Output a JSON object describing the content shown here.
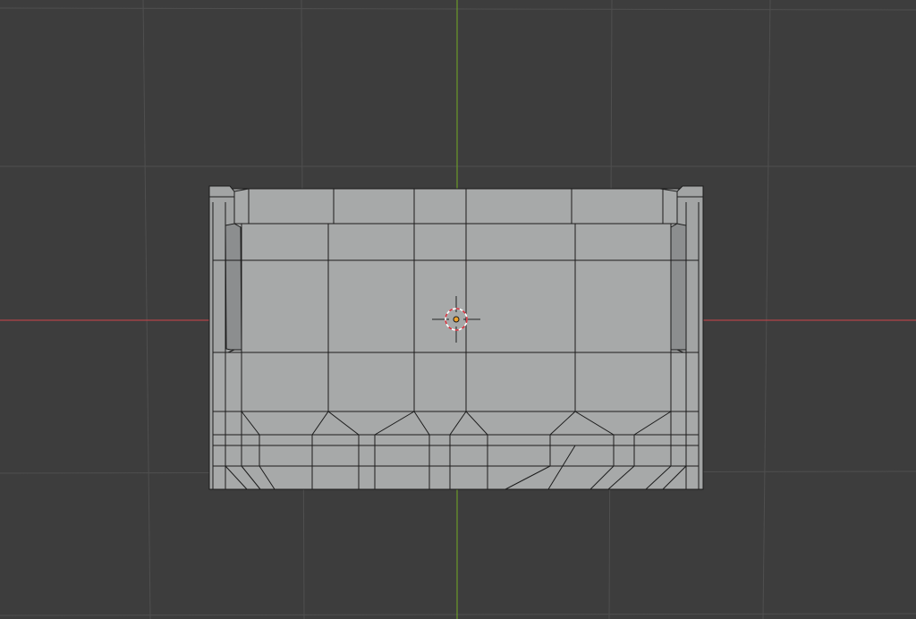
{
  "viewport": {
    "view": "front-orthographic",
    "colors": {
      "background": "#3d3d3d",
      "grid": "#4f4f4f",
      "x_axis": "#b3444a",
      "z_axis": "#6a9a2a",
      "mesh_face": "#a7a9a9",
      "mesh_wire": "#1c1c1c"
    },
    "object": {
      "name": "mesh-object",
      "selected": false
    },
    "cursor": {
      "name": "3d-cursor"
    },
    "origin": {
      "name": "object-origin"
    }
  }
}
